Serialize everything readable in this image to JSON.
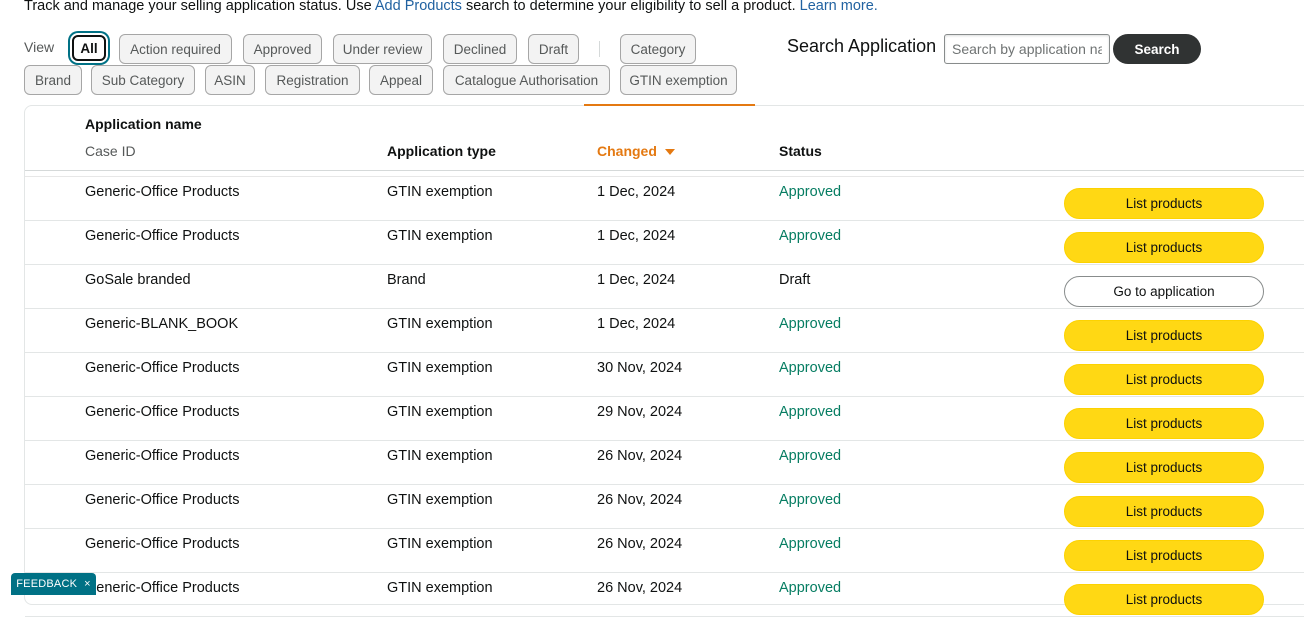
{
  "intro": {
    "text_before": "Track and manage your selling application status. Use ",
    "link1": "Add Products",
    "text_middle": " search to determine your eligibility to sell a product. ",
    "link2": "Learn more."
  },
  "filters": {
    "view_label": "View",
    "chips": [
      "All",
      "Action required",
      "Approved",
      "Under review",
      "Declined",
      "Draft",
      "Category",
      "Brand",
      "Sub Category",
      "ASIN",
      "Registration",
      "Appeal",
      "Catalogue Authorisation",
      "GTIN exemption"
    ],
    "active": "All"
  },
  "search": {
    "label": "Search Application",
    "placeholder": "Search by application name",
    "value": "",
    "button": "Search"
  },
  "table": {
    "headers": {
      "name": "Application name",
      "case_id": "Case ID",
      "type": "Application type",
      "changed": "Changed",
      "status": "Status"
    },
    "rows": [
      {
        "name": "Generic-Office Products",
        "type": "GTIN exemption",
        "changed": "1 Dec, 2024",
        "status": "Approved",
        "action": "List products"
      },
      {
        "name": "Generic-Office Products",
        "type": "GTIN exemption",
        "changed": "1 Dec, 2024",
        "status": "Approved",
        "action": "List products"
      },
      {
        "name": "GoSale branded",
        "type": "Brand",
        "changed": "1 Dec, 2024",
        "status": "Draft",
        "action": "Go to application"
      },
      {
        "name": "Generic-BLANK_BOOK",
        "type": "GTIN exemption",
        "changed": "1 Dec, 2024",
        "status": "Approved",
        "action": "List products"
      },
      {
        "name": "Generic-Office Products",
        "type": "GTIN exemption",
        "changed": "30 Nov, 2024",
        "status": "Approved",
        "action": "List products"
      },
      {
        "name": "Generic-Office Products",
        "type": "GTIN exemption",
        "changed": "29 Nov, 2024",
        "status": "Approved",
        "action": "List products"
      },
      {
        "name": "Generic-Office Products",
        "type": "GTIN exemption",
        "changed": "26 Nov, 2024",
        "status": "Approved",
        "action": "List products"
      },
      {
        "name": "Generic-Office Products",
        "type": "GTIN exemption",
        "changed": "26 Nov, 2024",
        "status": "Approved",
        "action": "List products"
      },
      {
        "name": "Generic-Office Products",
        "type": "GTIN exemption",
        "changed": "26 Nov, 2024",
        "status": "Approved",
        "action": "List products"
      },
      {
        "name": "Generic-Office Products",
        "type": "GTIN exemption",
        "changed": "26 Nov, 2024",
        "status": "Approved",
        "action": "List products"
      }
    ]
  },
  "feedback": {
    "label": "FEEDBACK",
    "close": "×"
  },
  "colors": {
    "accent_orange": "#e47911",
    "approved_green": "#067d62",
    "primary_yellow": "#ffd814",
    "link_blue": "#2162a1",
    "focus_teal": "#007185"
  }
}
